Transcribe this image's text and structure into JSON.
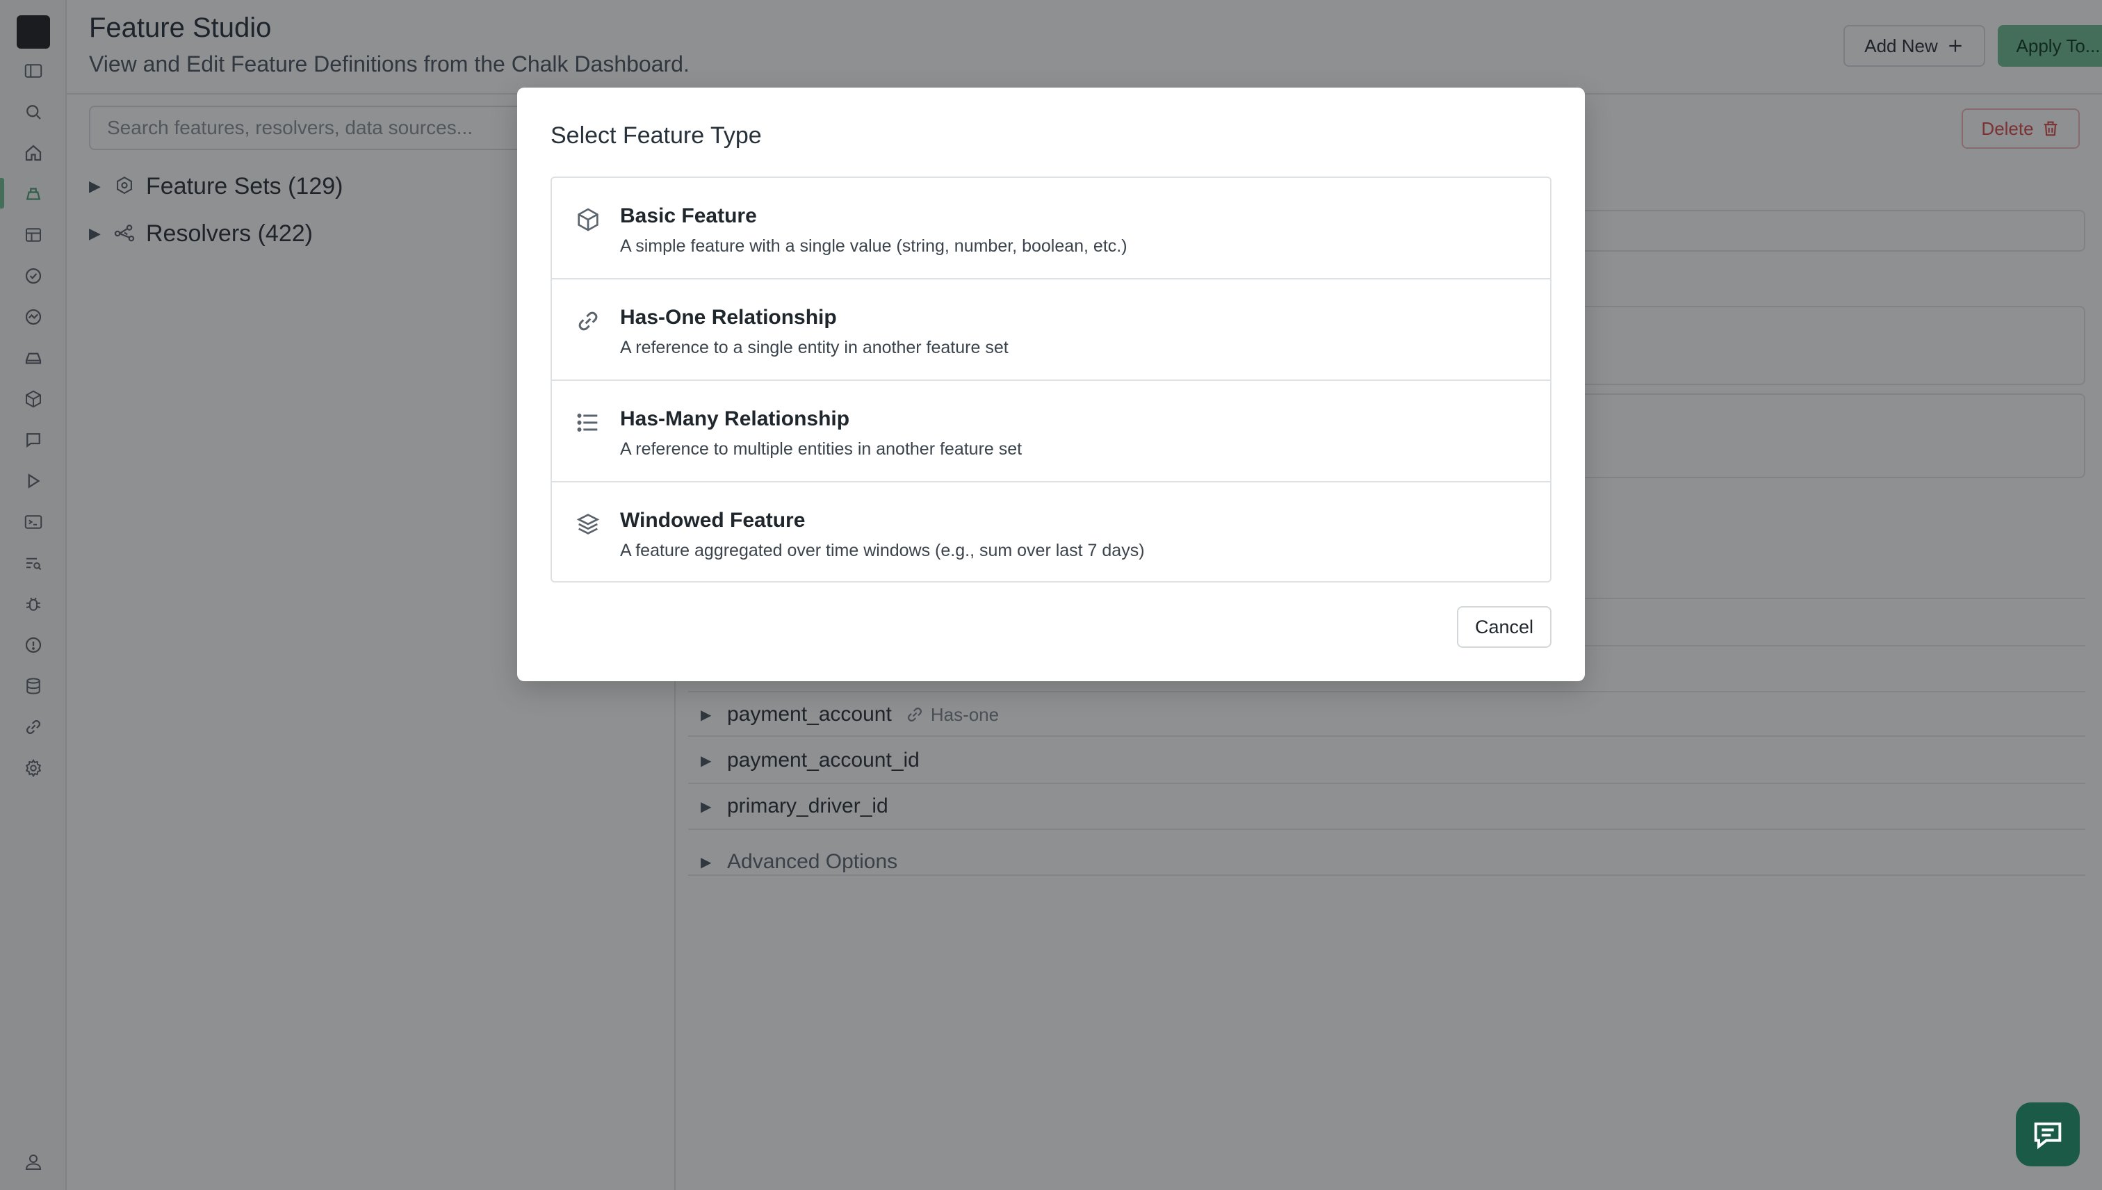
{
  "header": {
    "title": "Feature Studio",
    "subtitle": "View and Edit Feature Definitions from the Chalk Dashboard.",
    "add_new_label": "Add New",
    "apply_label": "Apply To..."
  },
  "sidebar": {
    "icons": [
      "sidebar-toggle-icon",
      "search-icon",
      "home-icon",
      "feature-studio-icon",
      "table-icon",
      "check-circle-icon",
      "activity-icon",
      "storage-icon",
      "cube-icon",
      "chat-icon",
      "play-icon",
      "terminal-icon",
      "query-search-icon",
      "bug-icon",
      "alert-icon",
      "database-icon",
      "link-icon",
      "gear-icon",
      "user-icon"
    ]
  },
  "left_pane": {
    "search_placeholder": "Search features, resolvers, data sources...",
    "tree": [
      {
        "label": "Feature Sets (129)",
        "icon": "feature-set-icon"
      },
      {
        "label": "Resolvers (422)",
        "icon": "resolver-graph-icon"
      }
    ]
  },
  "right_pane": {
    "delete_label": "Delete",
    "features": [
      {
        "name": "payment_account",
        "tag": "Has-one"
      },
      {
        "name": "payment_account_id"
      },
      {
        "name": "primary_driver_id"
      }
    ],
    "advanced_label": "Advanced Options"
  },
  "modal": {
    "title": "Select Feature Type",
    "options": [
      {
        "name": "Basic Feature",
        "description": "A simple feature with a single value (string, number, boolean, etc.)",
        "icon": "cube-icon"
      },
      {
        "name": "Has-One Relationship",
        "description": "A reference to a single entity in another feature set",
        "icon": "link-icon"
      },
      {
        "name": "Has-Many Relationship",
        "description": "A reference to multiple entities in another feature set",
        "icon": "list-icon"
      },
      {
        "name": "Windowed Feature",
        "description": "A feature aggregated over time windows (e.g., sum over last 7 days)",
        "icon": "layers-icon"
      }
    ],
    "cancel_label": "Cancel"
  },
  "colors": {
    "accent": "#6fbf95",
    "danger": "#d94b4b",
    "chat_fab": "#1a5a46"
  }
}
